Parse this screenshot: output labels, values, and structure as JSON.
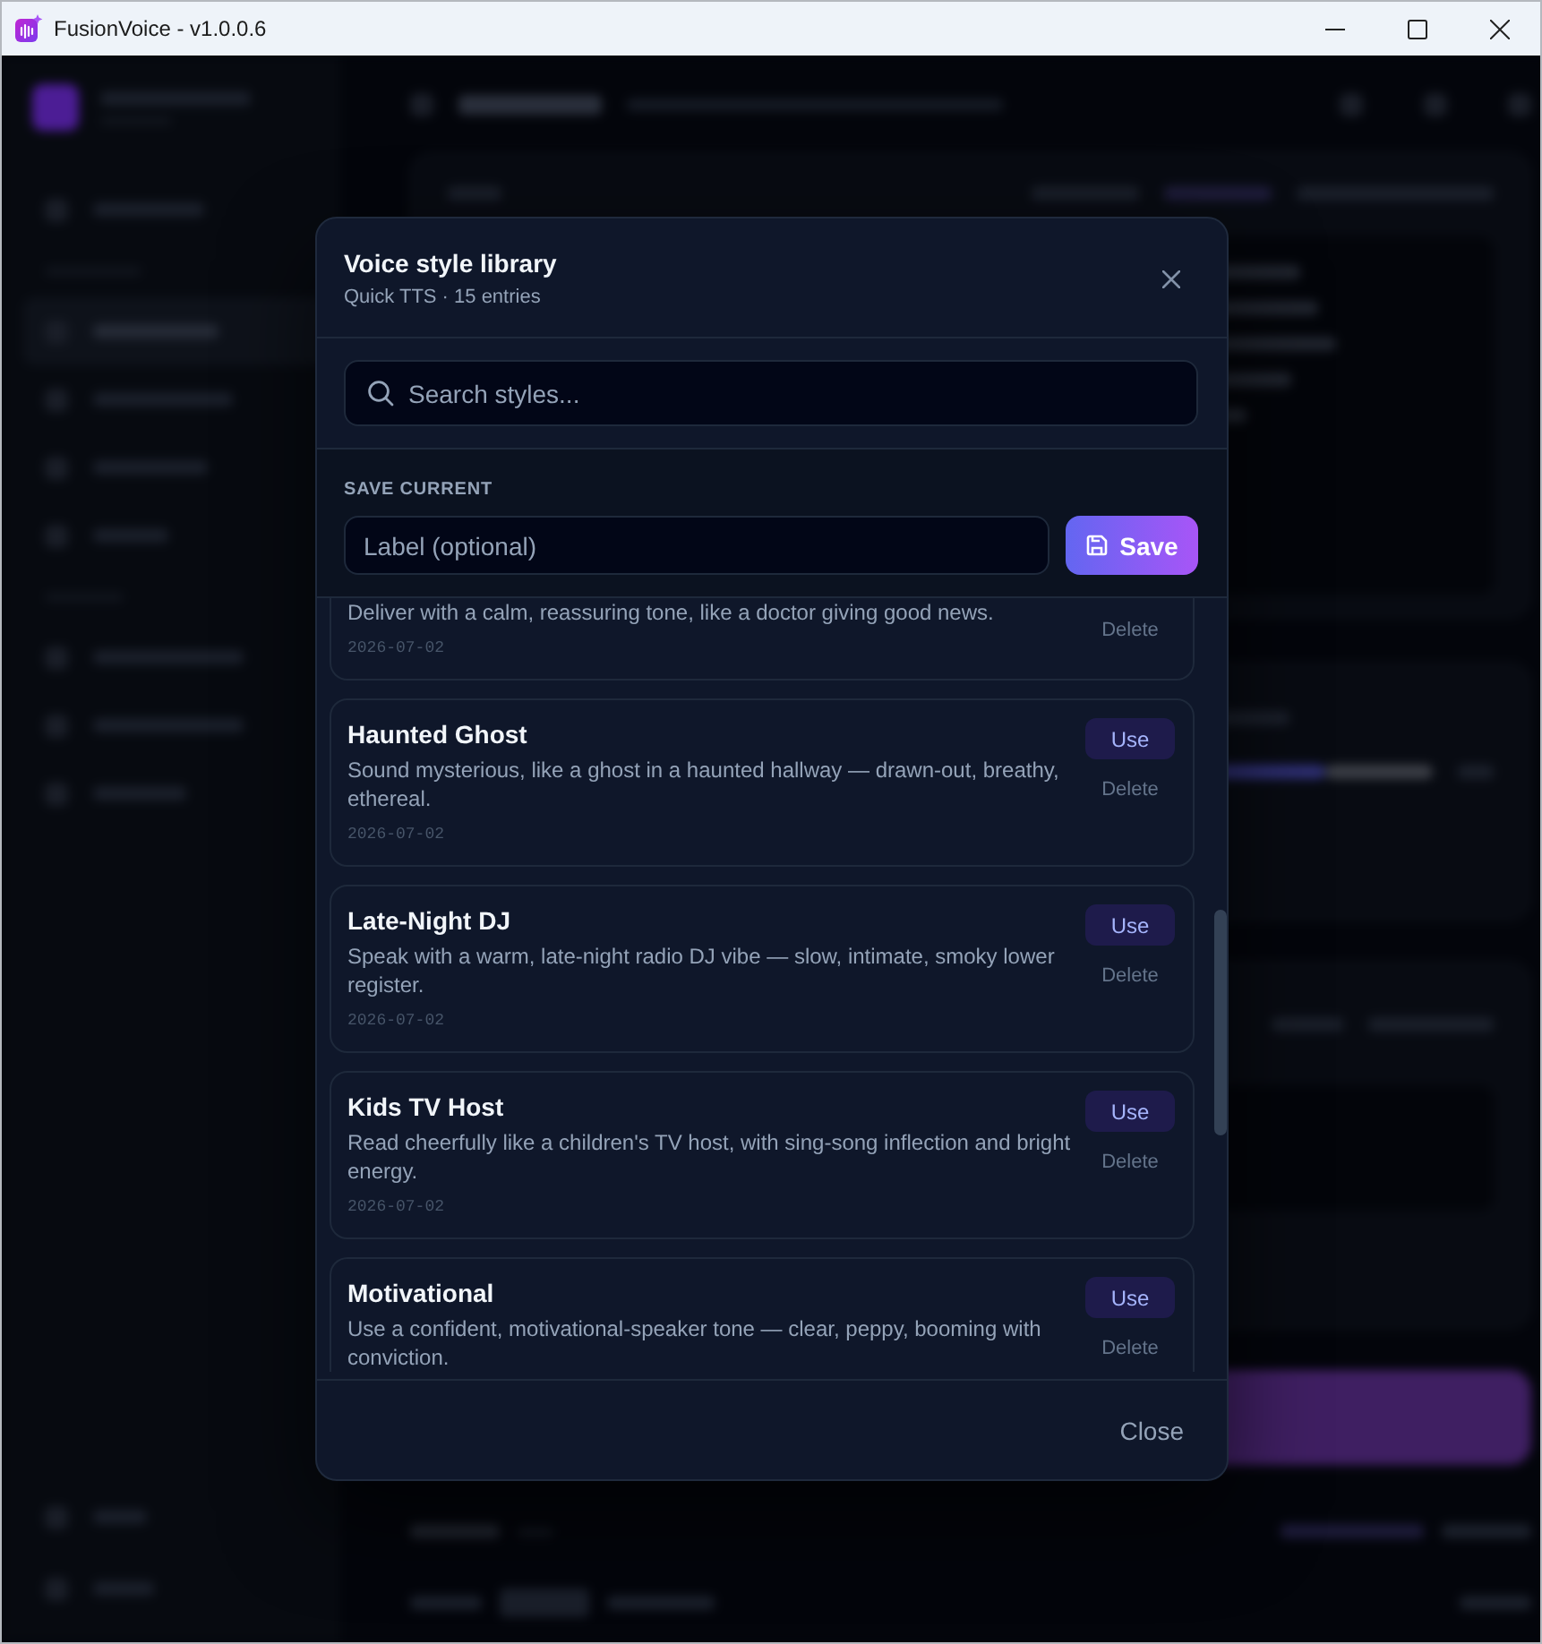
{
  "window": {
    "title": "FusionVoice - v1.0.0.6"
  },
  "dialog": {
    "title": "Voice style library",
    "subtitle": "Quick TTS · 15 entries",
    "search": {
      "placeholder": "Search styles..."
    },
    "save_current": {
      "heading": "SAVE CURRENT",
      "label_field": {
        "placeholder": "Label (optional)"
      },
      "save_button": "Save"
    },
    "styles": [
      {
        "description": "Deliver with a calm, reassuring tone, like a doctor giving good news.",
        "date": "2026-07-02",
        "delete_button": "Delete"
      },
      {
        "name": "Haunted Ghost",
        "description": "Sound mysterious, like a ghost in a haunted hallway — drawn-out, breathy, ethereal.",
        "date": "2026-07-02",
        "use_button": "Use",
        "delete_button": "Delete"
      },
      {
        "name": "Late-Night DJ",
        "description": "Speak with a warm, late-night radio DJ vibe — slow, intimate, smoky lower register.",
        "date": "2026-07-02",
        "use_button": "Use",
        "delete_button": "Delete"
      },
      {
        "name": "Kids TV Host",
        "description": "Read cheerfully like a children's TV host, with sing-song inflection and bright energy.",
        "date": "2026-07-02",
        "use_button": "Use",
        "delete_button": "Delete"
      },
      {
        "name": "Motivational",
        "description": "Use a confident, motivational-speaker tone — clear, peppy, booming with conviction.",
        "use_button": "Use",
        "delete_button": "Delete"
      }
    ],
    "close_button": "Close"
  }
}
